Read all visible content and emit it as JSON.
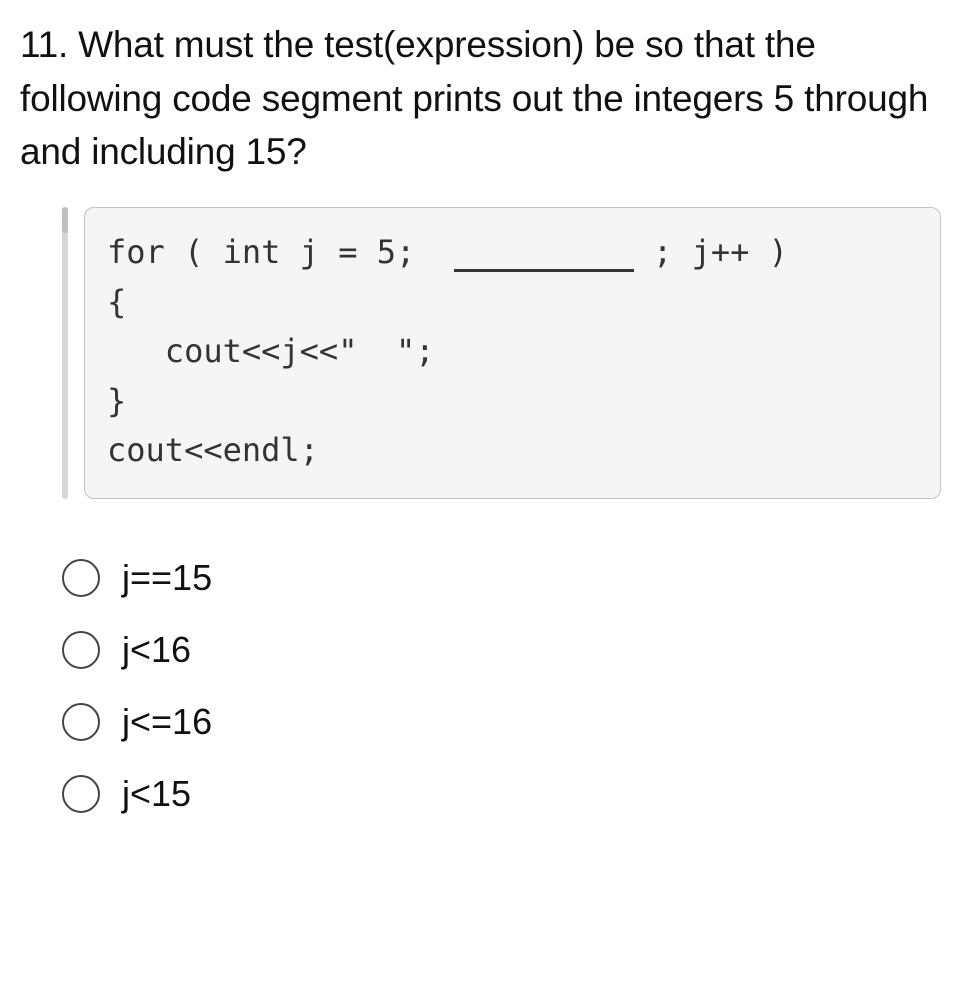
{
  "question": {
    "text": "11. What must the test(expression) be so that the following code segment  prints out the integers 5 through and including 15?"
  },
  "code": {
    "line1a": "for ( int j = 5;  ",
    "line1b": " ; j++ )",
    "line2": "{",
    "line3": "   cout<<j<<\"  \";",
    "line4": "}",
    "line5": "cout<<endl;"
  },
  "options": [
    {
      "label": "j==15"
    },
    {
      "label": "j<16"
    },
    {
      "label": "j<=16"
    },
    {
      "label": "j<15"
    }
  ]
}
